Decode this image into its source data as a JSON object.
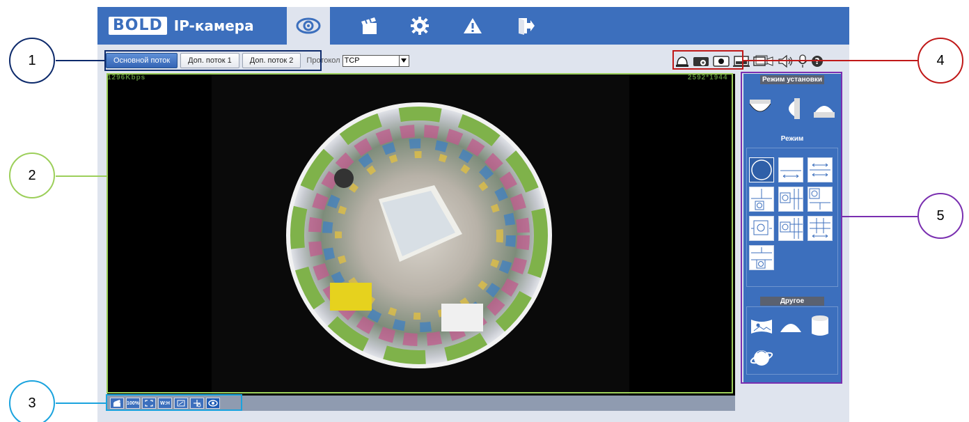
{
  "app": {
    "logo": "BOLD",
    "title": "IP-камера",
    "nav": [
      {
        "name": "live-view",
        "icon": "eye-icon",
        "active": true
      },
      {
        "name": "playback",
        "icon": "clapperboard-icon",
        "active": false
      },
      {
        "name": "settings",
        "icon": "gear-icon",
        "active": false
      },
      {
        "name": "alarm",
        "icon": "warning-icon",
        "active": false
      },
      {
        "name": "logout",
        "icon": "exit-icon",
        "active": false
      }
    ]
  },
  "streams": {
    "buttons": [
      "Основной поток",
      "Доп. поток 1",
      "Доп. поток 2"
    ],
    "active_index": 0,
    "protocol_label": "Протокол",
    "protocol_value": "TCP"
  },
  "tools": {
    "icons": [
      "alarm-bell-icon",
      "zoom-icon",
      "record-icon",
      "snapshot-icon",
      "triple-snapshot-icon",
      "speaker-icon",
      "microphone-icon",
      "help-icon"
    ]
  },
  "video": {
    "bitrate": "1296Kbps",
    "resolution": "2592*1944"
  },
  "bottombar": {
    "items": [
      "",
      "100%",
      "",
      "W:H",
      "",
      "",
      ""
    ],
    "icons": [
      "rotate-icon",
      "original-size-icon",
      "fullscreen-icon",
      "aspect-ratio-icon",
      "scale-icon",
      "ptz-icon",
      "view-icon"
    ]
  },
  "panel": {
    "install_mode": "Режим установки",
    "mode": "Режим",
    "other": "Другое",
    "install_icons": [
      "ceiling-mount-icon",
      "wall-mount-icon",
      "ground-mount-icon"
    ],
    "mode_icons": [
      "fisheye-icon",
      "panorama-180-icon",
      "panorama-360-icon",
      "split-1p1-icon",
      "split-1p2-icon",
      "split-1p3-icon",
      "split-1p4-icon",
      "split-1p6-icon",
      "split-1p8-icon",
      "split-1p8b-icon"
    ],
    "other_icons": [
      "panorama-image-icon",
      "half-sphere-icon",
      "cylinder-icon",
      "planet-icon"
    ]
  },
  "callouts": [
    "1",
    "2",
    "3",
    "4",
    "5"
  ],
  "colors": {
    "callout1": "#0d2a6b",
    "callout2": "#9ccf5a",
    "callout3": "#1aa3de",
    "callout4": "#c01818",
    "callout5": "#7a2fb0"
  }
}
